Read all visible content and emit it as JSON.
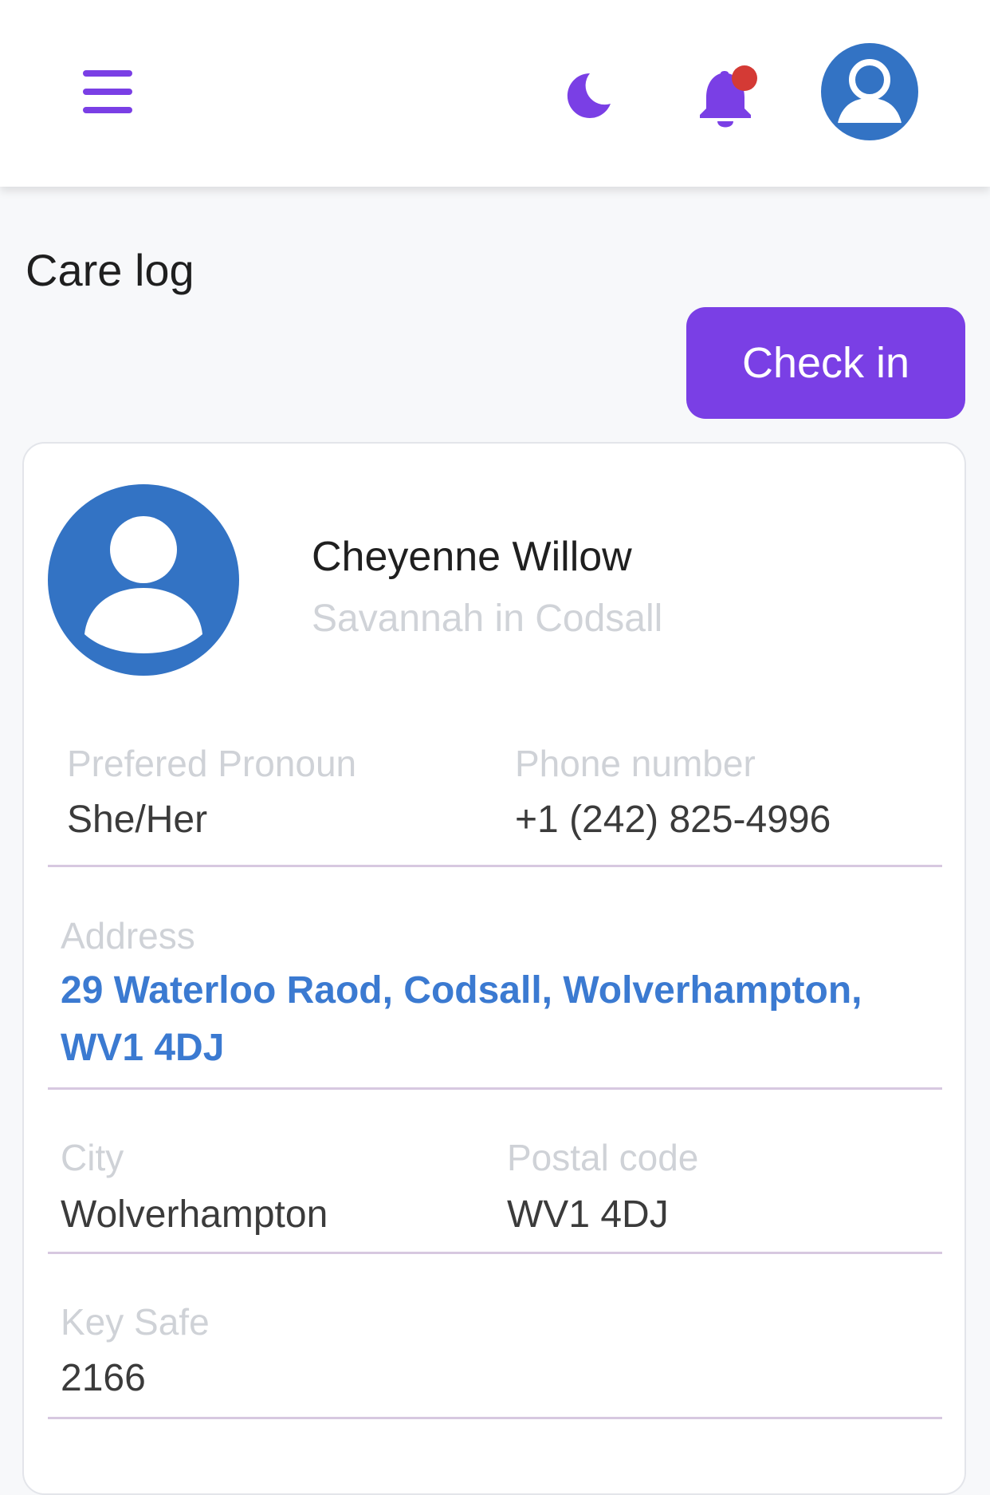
{
  "colors": {
    "accent": "#7a3fe5",
    "avatar_blue": "#3373c4",
    "notification_dot": "#d43a35"
  },
  "header": {
    "menu_icon": "hamburger-icon",
    "theme_icon": "moon-icon",
    "notification_icon": "bell-icon",
    "has_notification": true,
    "avatar_icon": "user-avatar-icon"
  },
  "page": {
    "title": "Care log",
    "check_in_label": "Check in"
  },
  "client": {
    "name": "Cheyenne Willow",
    "location": "Savannah in Codsall",
    "avatar_icon": "user-avatar-icon"
  },
  "fields": {
    "pronoun": {
      "label": "Prefered Pronoun",
      "value": "She/Her"
    },
    "phone": {
      "label": "Phone number",
      "value": "+1 (242) 825-4996"
    },
    "address": {
      "label": "Address",
      "value": "29 Waterloo Raod, Codsall, Wolverhampton, WV1 4DJ"
    },
    "city": {
      "label": "City",
      "value": "Wolverhampton"
    },
    "postal_code": {
      "label": "Postal code",
      "value": "WV1 4DJ"
    },
    "key_safe": {
      "label": "Key Safe",
      "value": "2166"
    }
  }
}
